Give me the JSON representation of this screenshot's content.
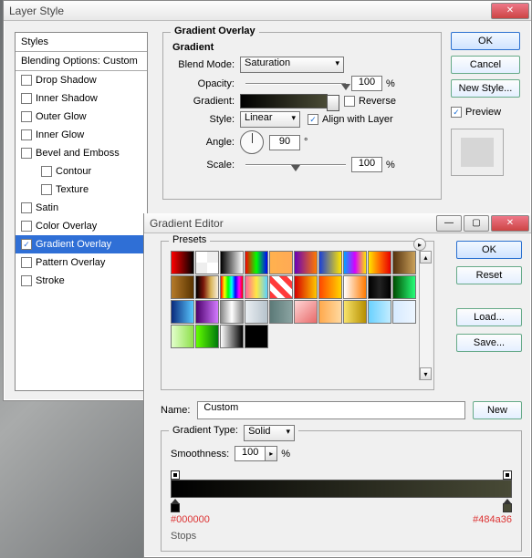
{
  "layerStyle": {
    "title": "Layer Style",
    "stylesHeader": "Styles",
    "blendingOptions": "Blending Options: Custom",
    "items": [
      {
        "label": "Drop Shadow",
        "checked": false
      },
      {
        "label": "Inner Shadow",
        "checked": false
      },
      {
        "label": "Outer Glow",
        "checked": false
      },
      {
        "label": "Inner Glow",
        "checked": false
      },
      {
        "label": "Bevel and Emboss",
        "checked": false
      },
      {
        "label": "Contour",
        "checked": false,
        "indent": true
      },
      {
        "label": "Texture",
        "checked": false,
        "indent": true
      },
      {
        "label": "Satin",
        "checked": false
      },
      {
        "label": "Color Overlay",
        "checked": false
      },
      {
        "label": "Gradient Overlay",
        "checked": true,
        "selected": true
      },
      {
        "label": "Pattern Overlay",
        "checked": false
      },
      {
        "label": "Stroke",
        "checked": false
      }
    ],
    "overlay": {
      "groupTitle": "Gradient Overlay",
      "subTitle": "Gradient",
      "blendModeLabel": "Blend Mode:",
      "blendMode": "Saturation",
      "opacityLabel": "Opacity:",
      "opacity": "100",
      "opacityUnit": "%",
      "gradientLabel": "Gradient:",
      "reverseLabel": "Reverse",
      "styleLabel": "Style:",
      "styleValue": "Linear",
      "alignLabel": "Align with Layer",
      "alignChecked": true,
      "angleLabel": "Angle:",
      "angle": "90",
      "angleUnit": "°",
      "scaleLabel": "Scale:",
      "scale": "100",
      "scaleUnit": "%"
    },
    "buttons": {
      "ok": "OK",
      "cancel": "Cancel",
      "newStyle": "New Style...",
      "previewLabel": "Preview",
      "previewChecked": true
    }
  },
  "gradientEditor": {
    "title": "Gradient Editor",
    "presetsLabel": "Presets",
    "presets": [
      "linear-gradient(90deg,#f00,#000)",
      "repeating-conic-gradient(#eee 0 25%, #fff 0 50%)",
      "linear-gradient(90deg,#000,#fff)",
      "linear-gradient(90deg,#f00,#0f0,#00f)",
      "linear-gradient(90deg,#ffb14e,#fa5)",
      "linear-gradient(90deg,#6a00b8,#ff7a00)",
      "linear-gradient(90deg,#1b3fd6,#ffe600)",
      "linear-gradient(90deg,#00a2ff,#d600ff,#ffe600)",
      "linear-gradient(90deg,#ffe600,#ff6a00,#e60000)",
      "linear-gradient(90deg,#55330f,#caa15a)",
      "linear-gradient(90deg,#b57a2a,#5a3400)",
      "linear-gradient(90deg,#000,#7a160a,#d8b45a,#f7eedc)",
      "linear-gradient(90deg,#f00,#ff0,#0f0,#0ff,#00f,#f0f,#f00)",
      "linear-gradient(90deg,#ff64a0,#ffe842,#5ad1ff)",
      "repeating-linear-gradient(45deg,#ff3a3a 0 6px,#fff 6px 12px)",
      "linear-gradient(90deg,#d60000,#ffc800)",
      "linear-gradient(90deg,#ff4800,#ffd400)",
      "linear-gradient(90deg,#ffffff,#ff7a00)",
      "linear-gradient(90deg,#000,#222,#000)",
      "linear-gradient(90deg,#004d00,#27ff7a)",
      "linear-gradient(90deg,#0a2a7c,#59c7ff)",
      "linear-gradient(90deg,#4d006e,#d37bff)",
      "linear-gradient(90deg,#888,#fff,#888)",
      "linear-gradient(90deg,#e9eef2,#b7c3cc)",
      "linear-gradient(90deg,#5c7a78,#8aa3a1)",
      "linear-gradient(135deg,#ffd6d6,#e86a6a)",
      "linear-gradient(90deg,#ffa94d,#ffd9a0)",
      "linear-gradient(90deg,#f7e36b,#b68f00)",
      "linear-gradient(90deg,#6ad1ff,#c2ecff)",
      "linear-gradient(90deg,#d6eaff,#eef6ff)",
      "linear-gradient(90deg,#e3ffcc,#8de04a)",
      "linear-gradient(90deg,#64ff00,#007a0a)",
      "linear-gradient(90deg,#fff,#000)",
      "linear-gradient(90deg,#000,#000)"
    ],
    "buttons": {
      "ok": "OK",
      "reset": "Reset",
      "load": "Load...",
      "save": "Save..."
    },
    "nameLabel": "Name:",
    "name": "Custom",
    "newBtn": "New",
    "typeLabel": "Gradient Type:",
    "type": "Solid",
    "smoothLabel": "Smoothness:",
    "smooth": "100",
    "smoothUnit": "%",
    "leftColor": "#000000",
    "rightColor": "#484a36",
    "stopsLabel": "Stops"
  }
}
